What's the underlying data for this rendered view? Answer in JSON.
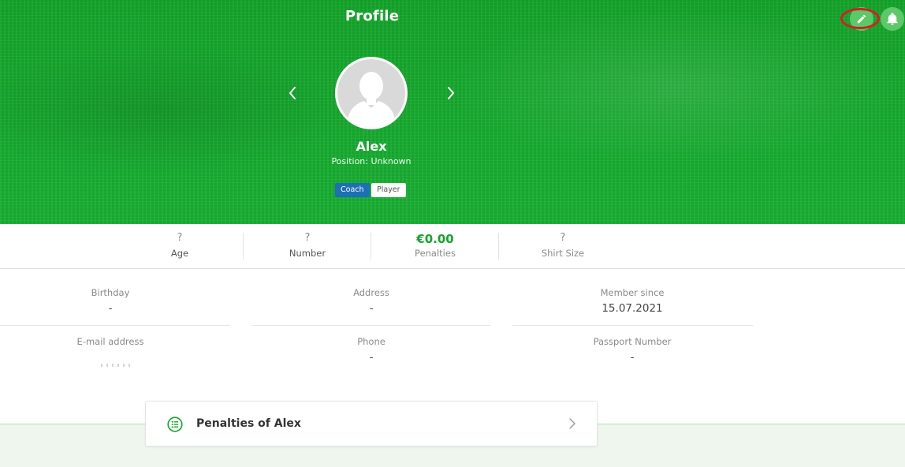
{
  "header": {
    "title": "Profile"
  },
  "profile": {
    "name": "Alex",
    "position": "Position: Unknown",
    "roles": [
      "Coach",
      "Player"
    ]
  },
  "stats": [
    {
      "value": "?",
      "label": "Age"
    },
    {
      "value": "?",
      "label": "Number"
    },
    {
      "value": "€0.00",
      "label": "Penalties"
    },
    {
      "value": "?",
      "label": "Shirt Size"
    }
  ],
  "fields": {
    "birthday": {
      "label": "Birthday",
      "value": "-"
    },
    "address": {
      "label": "Address",
      "value": "-"
    },
    "member_since": {
      "label": "Member since",
      "value": "15.07.2021"
    },
    "email": {
      "label": "E-mail address"
    },
    "phone": {
      "label": "Phone",
      "value": "-"
    },
    "passport": {
      "label": "Passport Number",
      "value": "-"
    }
  },
  "penalties_card": {
    "label": "Penalties of Alex"
  },
  "colors": {
    "brand_green": "#16aa2e",
    "coach_badge": "#1d6fb6",
    "edit_highlight": "#d51e24"
  },
  "icons": {
    "edit": "pencil-icon",
    "notifications": "bell-icon",
    "prev": "chevron-left-icon",
    "next": "chevron-right-icon",
    "avatar": "person-silhouette-icon",
    "penalties": "list-icon",
    "card_arrow": "chevron-right-icon"
  }
}
